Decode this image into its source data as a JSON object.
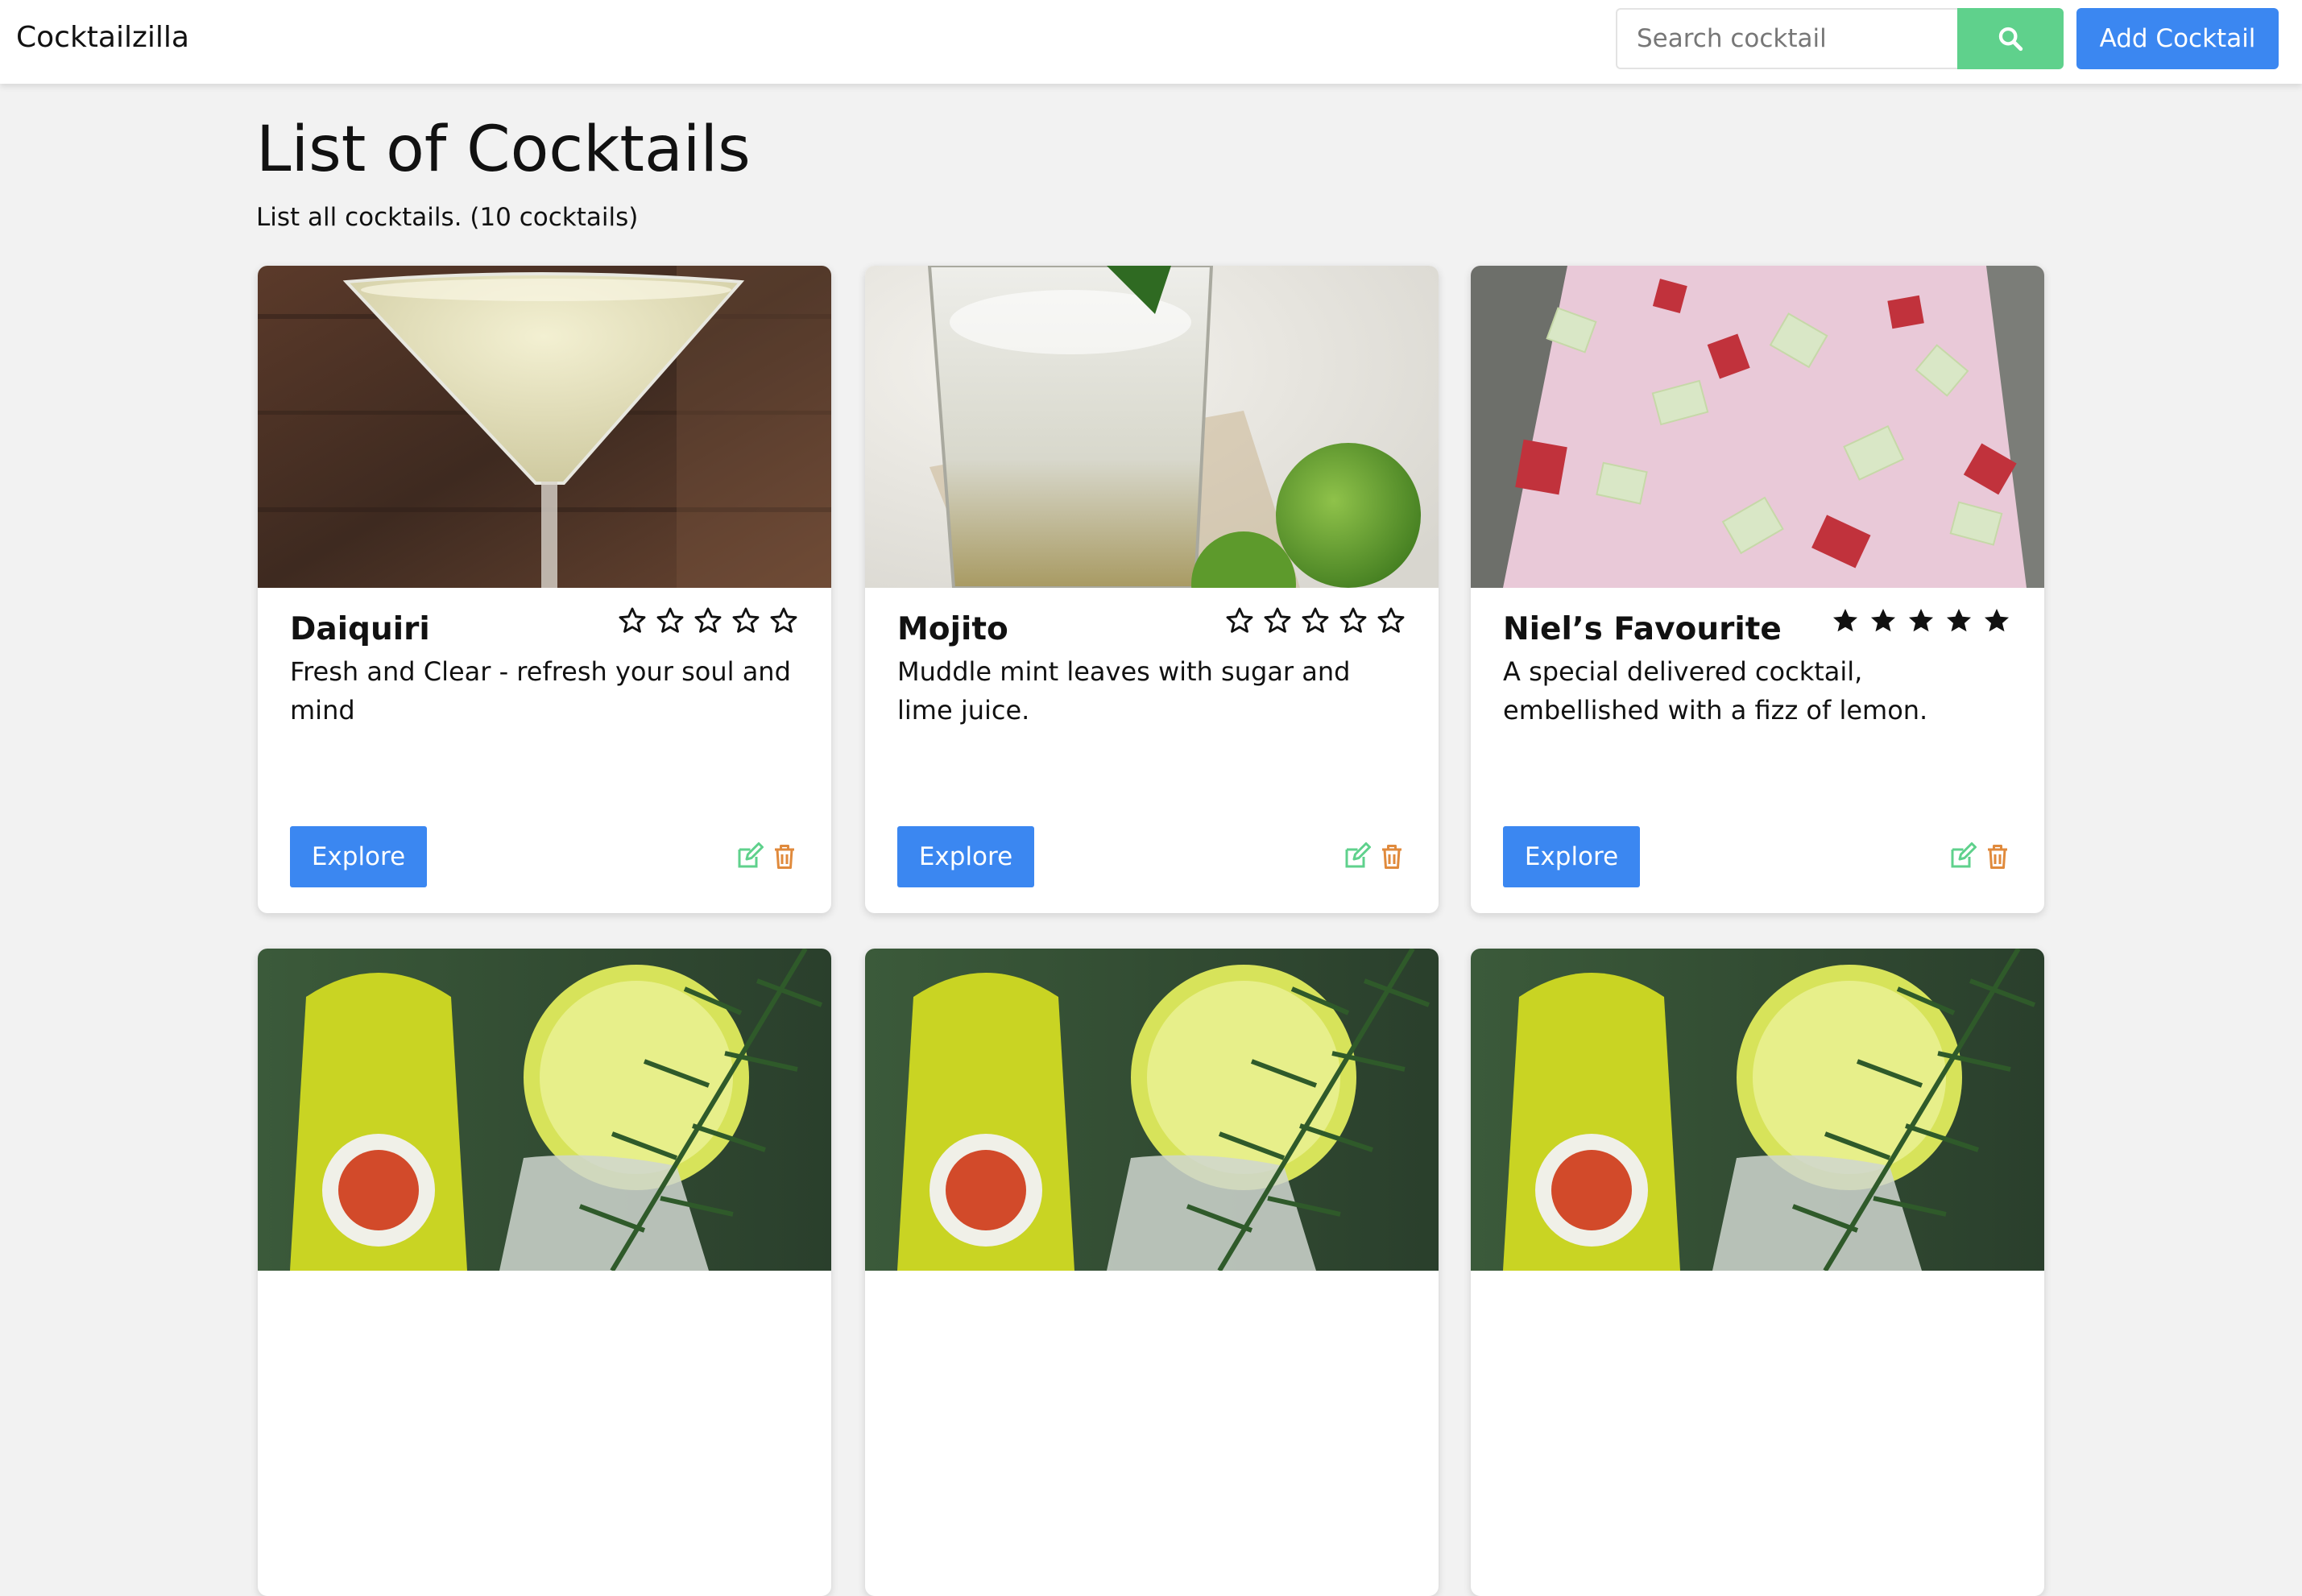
{
  "navbar": {
    "brand": "Cocktailzilla",
    "search_placeholder": "Search cocktail",
    "search_icon": "search-icon",
    "add_label": "Add Cocktail"
  },
  "header": {
    "title": "List of Cocktails",
    "subtitle": "List all cocktails. (10 cocktails)"
  },
  "colors": {
    "primary": "#3b87f1",
    "success": "#5fd18c",
    "edit_icon": "#5fd18c",
    "delete_icon": "#e08a3c"
  },
  "cards": [
    {
      "name": "Daiquiri",
      "rating": 0,
      "max_rating": 5,
      "description": "Fresh and Clear - refresh your soul and mind",
      "explore_label": "Explore",
      "image": "daiquiri-photo",
      "edit_icon": "edit-icon",
      "delete_icon": "trash-icon"
    },
    {
      "name": "Mojito",
      "rating": 0,
      "max_rating": 5,
      "description": "Muddle mint leaves with sugar and lime juice.",
      "explore_label": "Explore",
      "image": "mojito-photo",
      "edit_icon": "edit-icon",
      "delete_icon": "trash-icon"
    },
    {
      "name": "Niel’s Favourite",
      "rating": 5,
      "max_rating": 5,
      "description": "A special delivered cocktail, embellished with a fizz of lemon.",
      "explore_label": "Explore",
      "image": "fruit-punch-photo",
      "edit_icon": "edit-icon",
      "delete_icon": "trash-icon"
    },
    {
      "image": "rosemary-lime-cocktail-photo"
    },
    {
      "image": "rosemary-lime-cocktail-photo"
    },
    {
      "image": "rosemary-lime-cocktail-photo"
    }
  ]
}
